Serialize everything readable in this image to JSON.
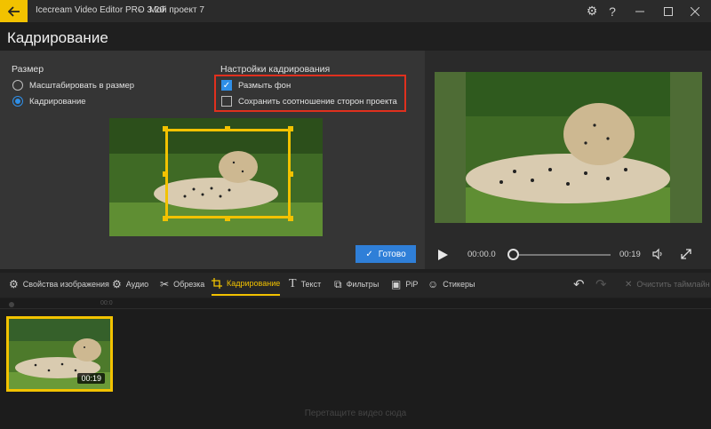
{
  "titlebar": {
    "app_title": "Icecream Video Editor PRO 3.20",
    "separator": "-",
    "project_title": "Мой проект 7"
  },
  "page": {
    "title": "Кадрирование"
  },
  "size": {
    "label": "Размер",
    "options": [
      {
        "label": "Масштабировать в размер",
        "selected": false
      },
      {
        "label": "Кадрирование",
        "selected": true
      }
    ]
  },
  "crop_settings": {
    "label": "Настройки кадрирования",
    "options": [
      {
        "label": "Размыть фон",
        "checked": true
      },
      {
        "label": "Сохранить соотношение сторон проекта",
        "checked": false
      }
    ]
  },
  "done_button": {
    "label": "Готово"
  },
  "player": {
    "current_time": "00:00.0",
    "total_time": "00:19",
    "progress": 0
  },
  "toolbar": {
    "tools": [
      {
        "label": "Свойства изображения",
        "icon": "gear-icon"
      },
      {
        "label": "Аудио",
        "icon": "gear-icon"
      },
      {
        "label": "Обрезка",
        "icon": "scissors-icon"
      },
      {
        "label": "Кадрирование",
        "icon": "crop-icon",
        "active": true
      },
      {
        "label": "Текст",
        "icon": "text-icon"
      },
      {
        "label": "Фильтры",
        "icon": "filter-icon"
      },
      {
        "label": "PiP",
        "icon": "pip-icon"
      },
      {
        "label": "Стикеры",
        "icon": "smile-icon"
      }
    ],
    "clear_timeline": "Очистить таймлайн"
  },
  "timeline": {
    "ruler_mark": "00:0",
    "clip_duration": "00:19",
    "drag_hint": "Перетащите видео сюда"
  },
  "colors": {
    "accent": "#f2c200",
    "primary_button": "#2f7fd8",
    "highlight_border": "#e0301e"
  }
}
